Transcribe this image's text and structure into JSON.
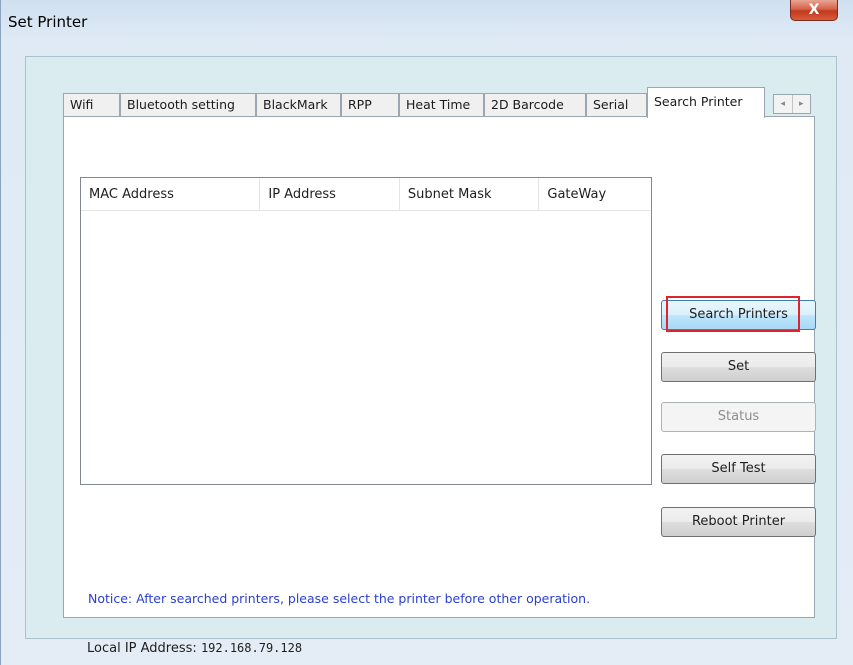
{
  "window": {
    "title": "Set Printer",
    "close_glyph": "X"
  },
  "tabs": [
    {
      "label": "Wifi"
    },
    {
      "label": "Bluetooth setting"
    },
    {
      "label": "BlackMark"
    },
    {
      "label": "RPP"
    },
    {
      "label": "Heat Time"
    },
    {
      "label": "2D Barcode"
    },
    {
      "label": "Serial"
    },
    {
      "label": "Search Printer",
      "active": true
    }
  ],
  "tab_scroll": {
    "left_glyph": "◂",
    "right_glyph": "▸"
  },
  "table": {
    "columns": [
      "MAC Address",
      "IP Address",
      "Subnet Mask",
      "GateWay"
    ],
    "rows": []
  },
  "buttons": {
    "search_printers": "Search Printers",
    "set": "Set",
    "status": "Status",
    "self_test": "Self Test",
    "reboot_printer": "Reboot Printer"
  },
  "notice": "Notice: After searched printers, please select the printer before other operation.",
  "local_ip": {
    "label": "Local IP Address:",
    "value": "192.168.79.128"
  },
  "colors": {
    "highlight": "#e0242e",
    "notice_text": "#2b3fd0",
    "close_button": "#c2391c"
  }
}
